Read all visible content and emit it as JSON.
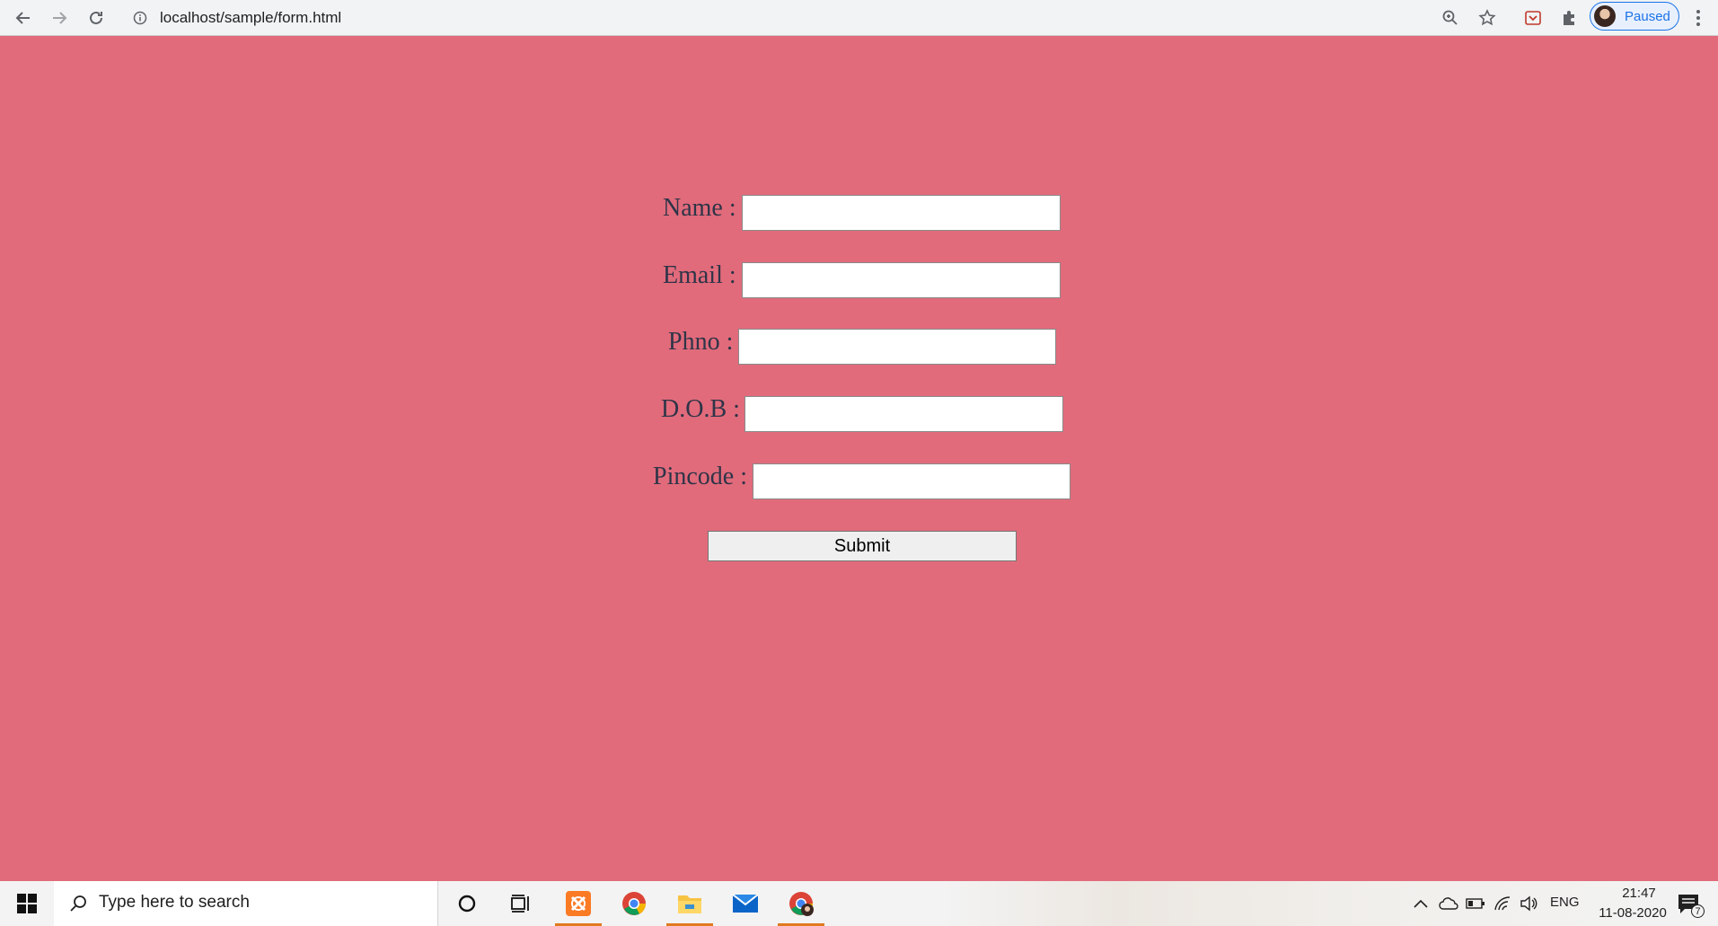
{
  "browser": {
    "url": "localhost/sample/form.html",
    "profile_status": "Paused"
  },
  "form": {
    "fields": [
      {
        "label": "Name :",
        "value": ""
      },
      {
        "label": "Email :",
        "value": ""
      },
      {
        "label": "Phno :",
        "value": ""
      },
      {
        "label": "D.O.B :",
        "value": ""
      },
      {
        "label": "Pincode :",
        "value": ""
      }
    ],
    "submit_label": "Submit",
    "page_background": "#e16b7b"
  },
  "taskbar": {
    "search_placeholder": "Type here to search",
    "language": "ENG",
    "time": "21:47",
    "date": "11-08-2020",
    "notification_count": "7",
    "pinned_apps": [
      "cortana-icon",
      "task-view-icon",
      "xampp-icon",
      "chrome-icon",
      "file-explorer-icon",
      "mail-icon",
      "chrome-profile-icon"
    ],
    "accent_color": "#e07b20"
  }
}
